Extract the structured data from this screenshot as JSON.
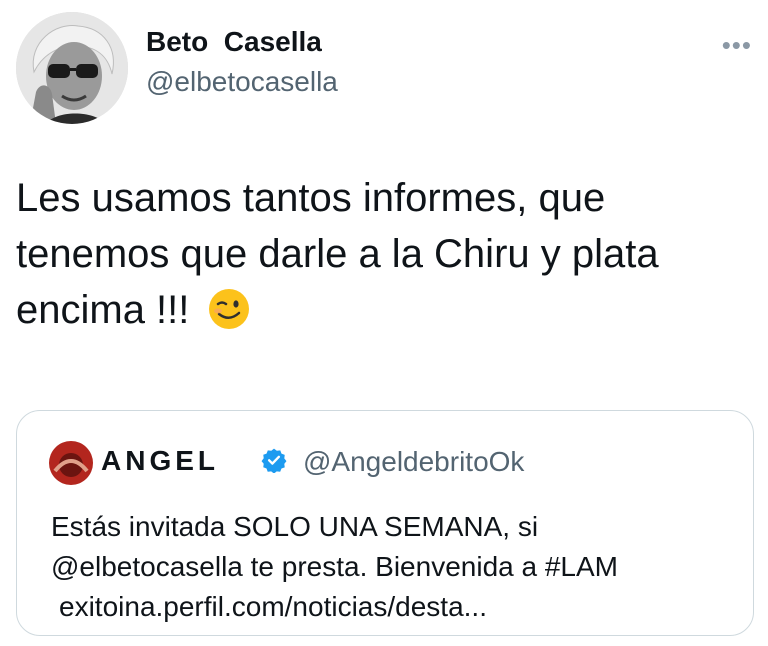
{
  "author": {
    "display_name": "Beto  Casella",
    "handle": "@elbetocasella"
  },
  "menu_icon": "more-horizontal-icon",
  "tweet": {
    "text": "Les usamos tantos informes, que tenemos que darle a la Chiru y plata encima !!!",
    "emoji": "winking-face"
  },
  "quoted_tweet": {
    "display_name": "ANGEL",
    "verified": true,
    "handle": "@AngeldebritoOk",
    "line1": "Estás invitada SOLO UNA SEMANA, si",
    "line2": "@elbetocasella te presta. Bienvenida a #LAM",
    "link": "exitoina.perfil.com/noticias/desta..."
  },
  "colors": {
    "text": "#0f1419",
    "secondary": "#536471",
    "border": "#cfd9de",
    "verified": "#1d9bf0"
  }
}
